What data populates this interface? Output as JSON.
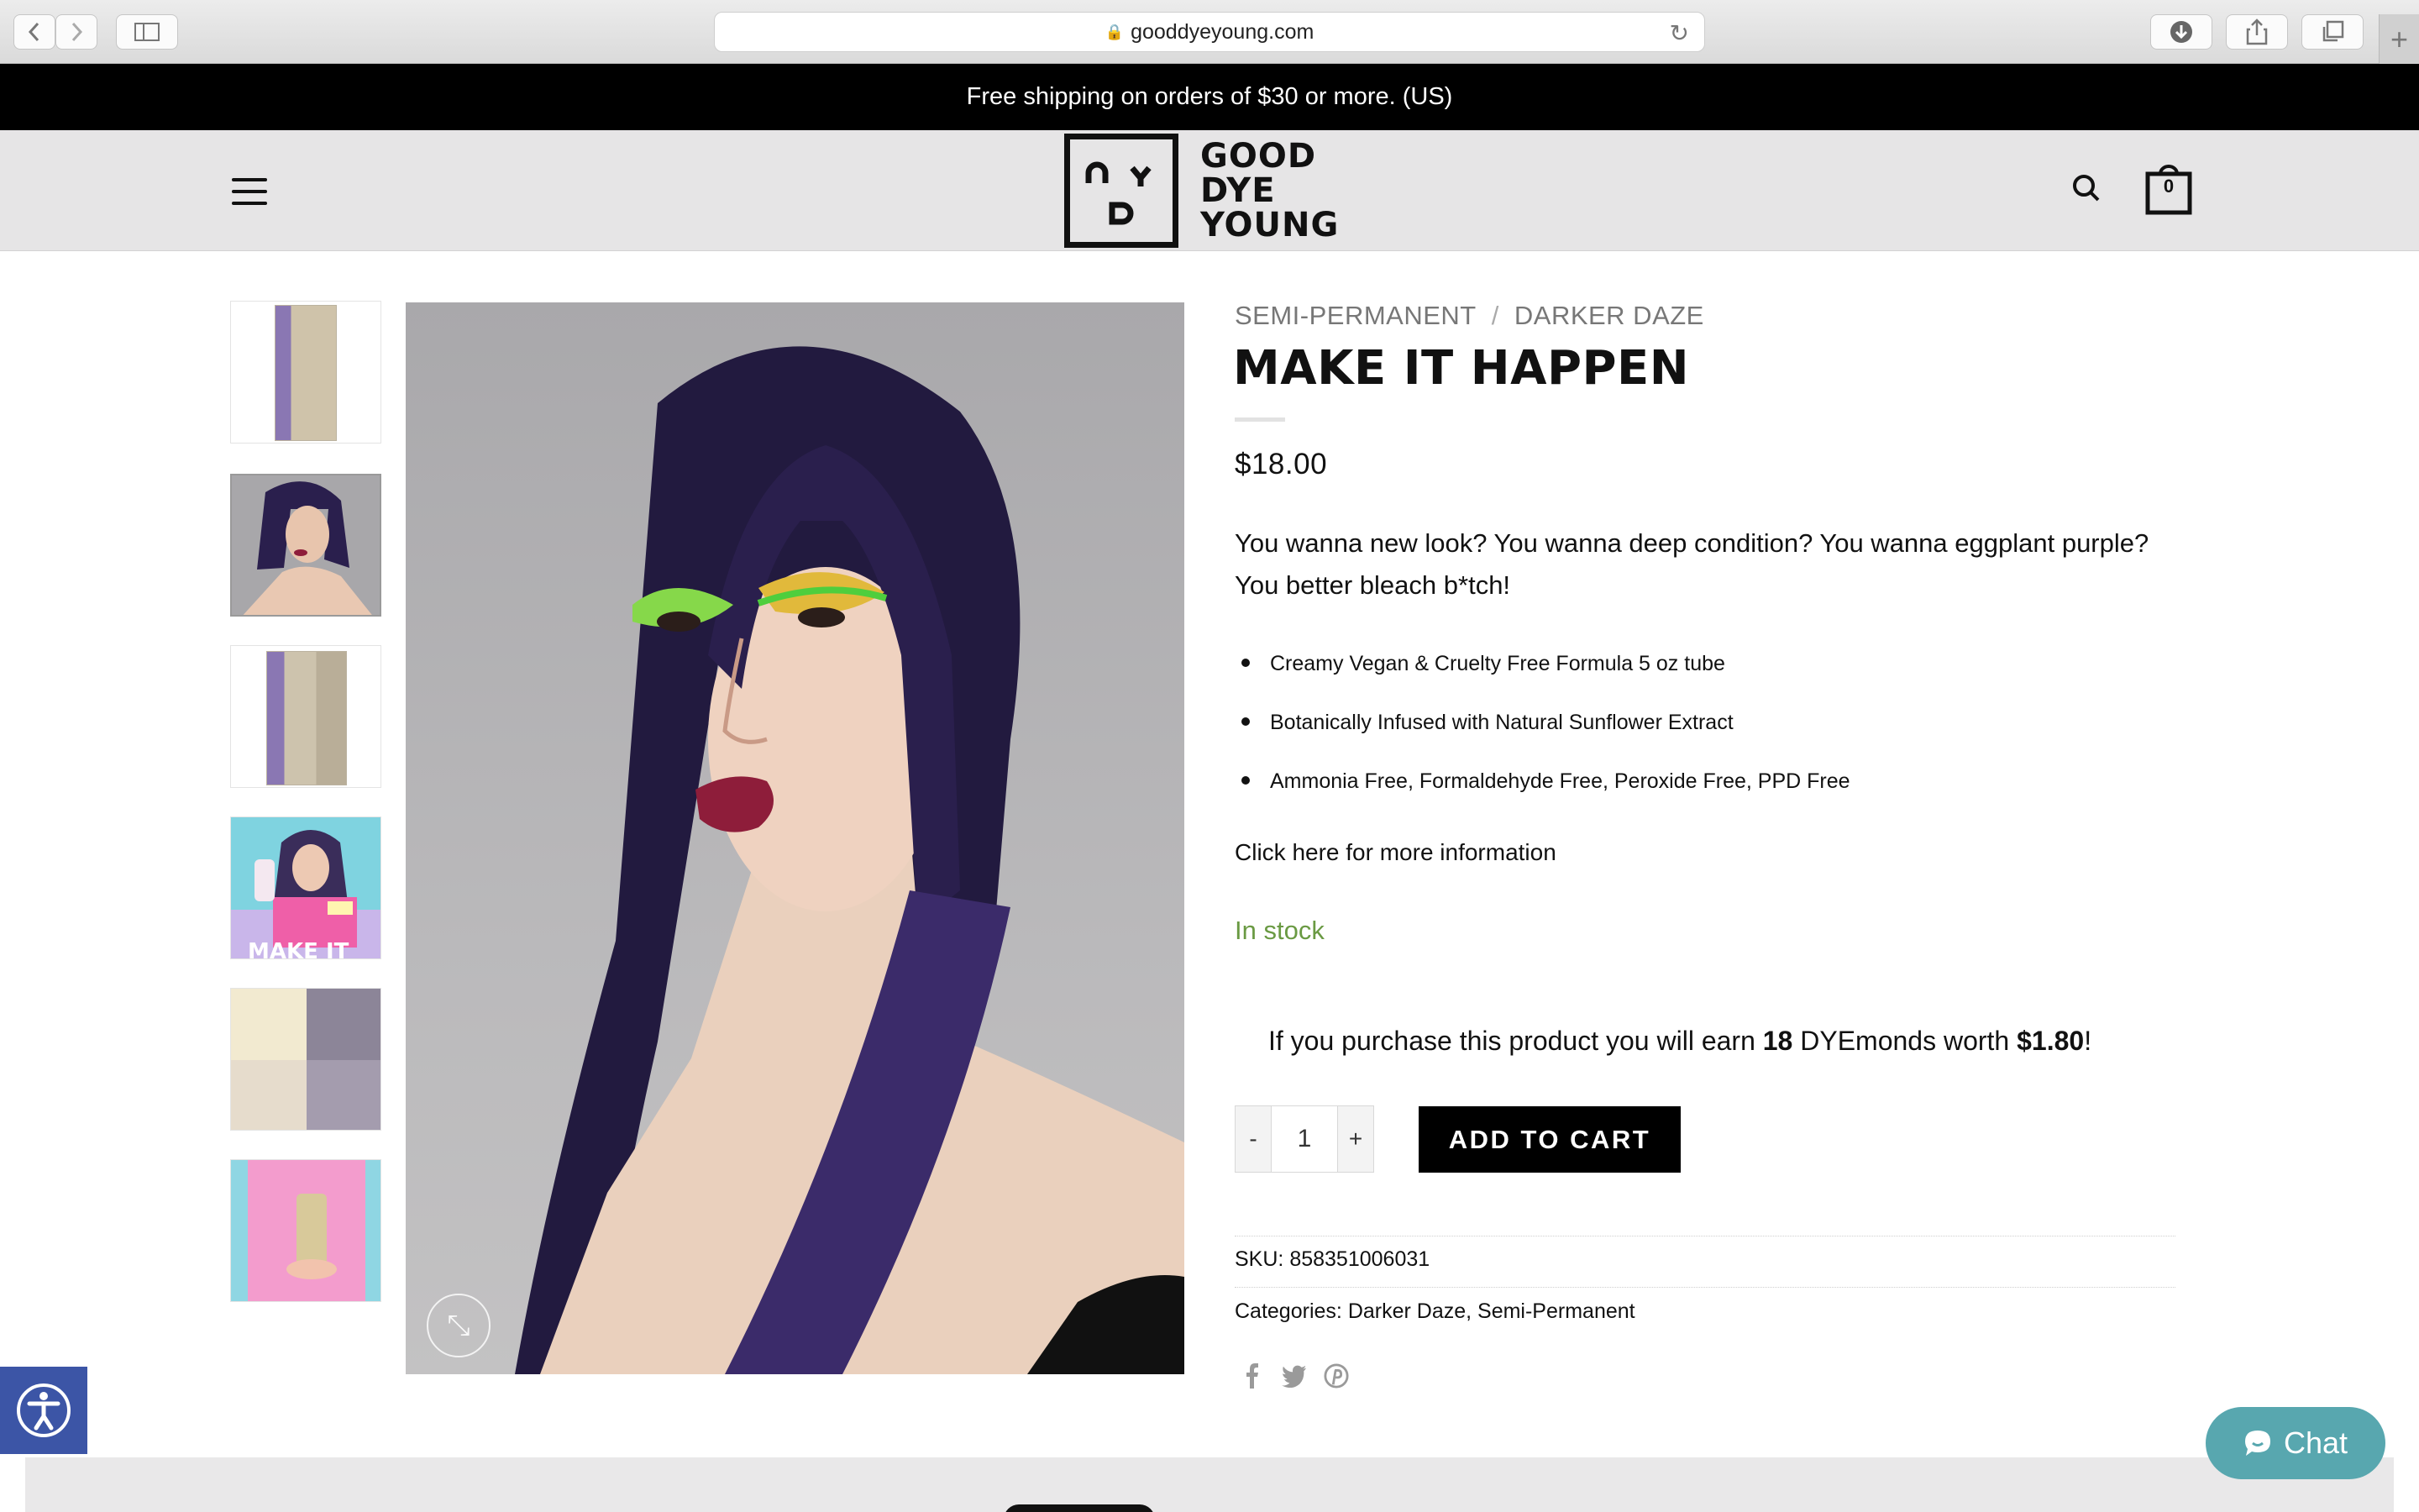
{
  "browser": {
    "url": "gooddyeyoung.com",
    "back_icon": "chevron-left-icon",
    "forward_icon": "chevron-right-icon",
    "sidebar_icon": "sidebar-icon",
    "reload_icon": "reload-icon",
    "download_icon": "download-icon",
    "share_icon": "share-icon",
    "tabs_icon": "tabs-icon",
    "new_tab_label": "+"
  },
  "promo": {
    "text": "Free shipping on orders of $30 or more. (US)"
  },
  "header": {
    "logo_lines": [
      "GOOD",
      "DYE",
      "YOUNG"
    ],
    "cart_count": "0"
  },
  "product": {
    "breadcrumb": [
      "SEMI-PERMANENT",
      "DARKER DAZE"
    ],
    "breadcrumb_separator": "/",
    "title": "MAKE IT HAPPEN",
    "price": "$18.00",
    "description": "You wanna new look? You wanna deep condition? You wanna eggplant purple? You better bleach b*tch!",
    "bullets": [
      "Creamy Vegan & Cruelty Free Formula 5 oz tube",
      "Botanically Infused with Natural Sunflower Extract",
      "Ammonia Free, Formaldehyde Free, Peroxide Free, PPD Free"
    ],
    "more_info_link": "Click here for more information",
    "stock": "In stock",
    "points": {
      "prefix": "If you purchase this product you will earn ",
      "count": "18",
      "middle": " DYEmonds worth ",
      "value": "$1.80",
      "suffix": "!"
    },
    "quantity": "1",
    "qty_minus": "-",
    "qty_plus": "+",
    "add_to_cart": "ADD TO CART",
    "sku_label": "SKU:",
    "sku": "858351006031",
    "categories_label": "Categories:",
    "categories": "Darker Daze, Semi-Permanent",
    "share_icons": [
      "facebook-icon",
      "twitter-icon",
      "pinterest-icon"
    ]
  },
  "thumbnail_thumb_overlay_text": "MAKE IT",
  "chat": {
    "label": "Chat"
  },
  "colors": {
    "promo_bg": "#000000",
    "header_bg": "#e6e5e6",
    "stock_green": "#6a9a43",
    "chat_bg": "#58a7af",
    "accessibility_bg": "#3c55a6",
    "hair_purple": "#2a1f4d"
  }
}
